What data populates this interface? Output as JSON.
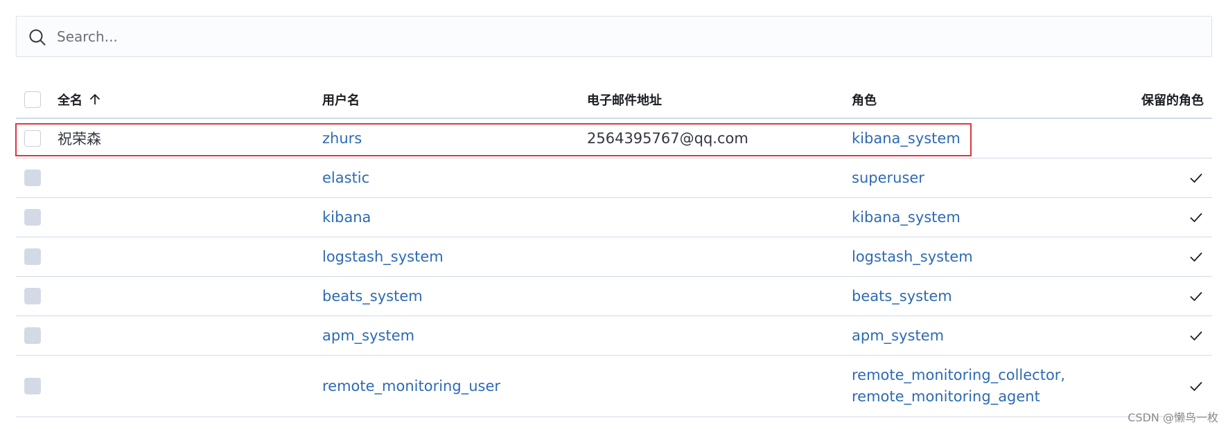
{
  "search": {
    "placeholder": "Search..."
  },
  "table": {
    "columns": {
      "full_name": "全名",
      "username": "用户名",
      "email": "电子邮件地址",
      "roles": "角色",
      "reserved": "保留的角色"
    },
    "sort": {
      "column": "full_name",
      "direction": "ascending"
    },
    "rows": [
      {
        "full_name": "祝荣森",
        "username": "zhurs",
        "email": "2564395767@qq.com",
        "roles": [
          "kibana_system"
        ],
        "reserved": false,
        "selectable": true
      },
      {
        "full_name": "",
        "username": "elastic",
        "email": "",
        "roles": [
          "superuser"
        ],
        "reserved": true,
        "selectable": false
      },
      {
        "full_name": "",
        "username": "kibana",
        "email": "",
        "roles": [
          "kibana_system"
        ],
        "reserved": true,
        "selectable": false
      },
      {
        "full_name": "",
        "username": "logstash_system",
        "email": "",
        "roles": [
          "logstash_system"
        ],
        "reserved": true,
        "selectable": false
      },
      {
        "full_name": "",
        "username": "beats_system",
        "email": "",
        "roles": [
          "beats_system"
        ],
        "reserved": true,
        "selectable": false
      },
      {
        "full_name": "",
        "username": "apm_system",
        "email": "",
        "roles": [
          "apm_system"
        ],
        "reserved": true,
        "selectable": false
      },
      {
        "full_name": "",
        "username": "remote_monitoring_user",
        "email": "",
        "roles": [
          "remote_monitoring_collector,",
          "remote_monitoring_agent"
        ],
        "reserved": true,
        "selectable": false
      }
    ]
  },
  "colors": {
    "link": "#2d6ab4",
    "highlight": "#e0343c",
    "text": "#343741"
  },
  "icons": {
    "search": "search-icon",
    "sort": "arrow-up-icon",
    "reserved": "check-icon"
  },
  "watermark": "CSDN @懒鸟一枚"
}
